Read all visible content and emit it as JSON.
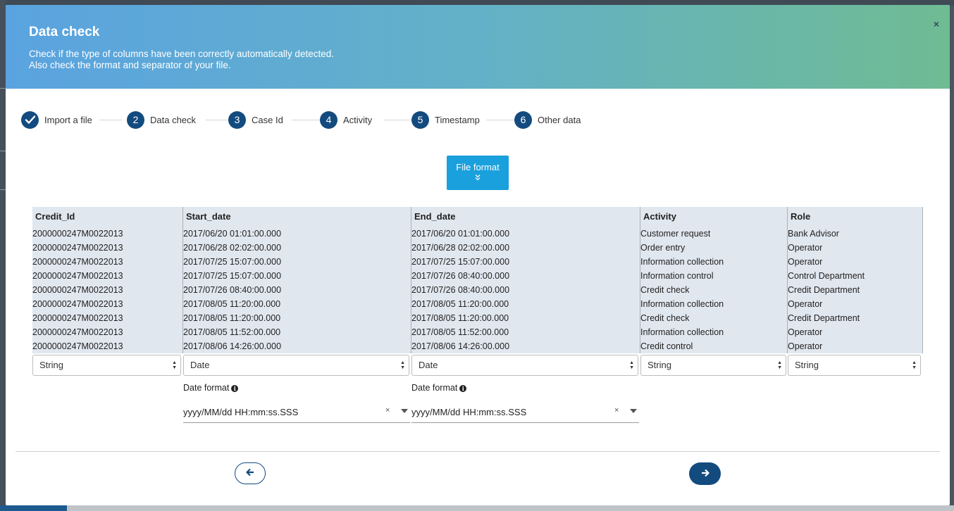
{
  "dialog": {
    "title": "Data check",
    "subtitle_line1": "Check if the type of columns have been correctly automatically detected.",
    "subtitle_line2": "Also check the format and separator of your file.",
    "close_glyph": "×"
  },
  "steps": [
    {
      "number": "✓",
      "label": "Import a file",
      "state": "done"
    },
    {
      "number": "2",
      "label": "Data check",
      "state": "current"
    },
    {
      "number": "3",
      "label": "Case Id",
      "state": "pending"
    },
    {
      "number": "4",
      "label": "Activity",
      "state": "pending"
    },
    {
      "number": "5",
      "label": "Timestamp",
      "state": "pending"
    },
    {
      "number": "6",
      "label": "Other data",
      "state": "pending"
    }
  ],
  "file_format_button": {
    "label": "File format",
    "icon": "chevron-double-down-icon",
    "glyph": "⌄⌄"
  },
  "table": {
    "columns": [
      "Credit_Id",
      "Start_date",
      "End_date",
      "Activity",
      "Role"
    ],
    "rows": [
      [
        "2000000247M0022013",
        "2017/06/20 01:01:00.000",
        "2017/06/20 01:01:00.000",
        "Customer request",
        "Bank Advisor"
      ],
      [
        "2000000247M0022013",
        "2017/06/28 02:02:00.000",
        "2017/06/28 02:02:00.000",
        "Order entry",
        "Operator"
      ],
      [
        "2000000247M0022013",
        "2017/07/25 15:07:00.000",
        "2017/07/25 15:07:00.000",
        "Information collection",
        "Operator"
      ],
      [
        "2000000247M0022013",
        "2017/07/25 15:07:00.000",
        "2017/07/26 08:40:00.000",
        "Information control",
        "Control Department"
      ],
      [
        "2000000247M0022013",
        "2017/07/26 08:40:00.000",
        "2017/07/26 08:40:00.000",
        "Credit check",
        "Credit Department"
      ],
      [
        "2000000247M0022013",
        "2017/08/05 11:20:00.000",
        "2017/08/05 11:20:00.000",
        "Information collection",
        "Operator"
      ],
      [
        "2000000247M0022013",
        "2017/08/05 11:20:00.000",
        "2017/08/05 11:20:00.000",
        "Credit check",
        "Credit Department"
      ],
      [
        "2000000247M0022013",
        "2017/08/05 11:52:00.000",
        "2017/08/05 11:52:00.000",
        "Information collection",
        "Operator"
      ],
      [
        "2000000247M0022013",
        "2017/08/06 14:26:00.000",
        "2017/08/06 14:26:00.000",
        "Credit control",
        "Operator"
      ]
    ],
    "types": [
      "String",
      "Date",
      "Date",
      "String",
      "String"
    ]
  },
  "date_formats": {
    "label": "Date format",
    "info_icon": "info-circle-icon",
    "start_date_value": "yyyy/MM/dd HH:mm:ss.SSS",
    "end_date_value": "yyyy/MM/dd HH:mm:ss.SSS",
    "clear_glyph": "×"
  },
  "navigation": {
    "prev_icon": "arrow-left-icon",
    "next_icon": "arrow-right-icon",
    "prev_glyph": "←",
    "next_glyph": "→"
  },
  "colors": {
    "accent": "#134b7f",
    "file_format_button": "#1aa0dc",
    "header_gradient_start": "#5aa3e0",
    "header_gradient_end": "#6fbb93",
    "table_background": "#e1e7ef"
  }
}
